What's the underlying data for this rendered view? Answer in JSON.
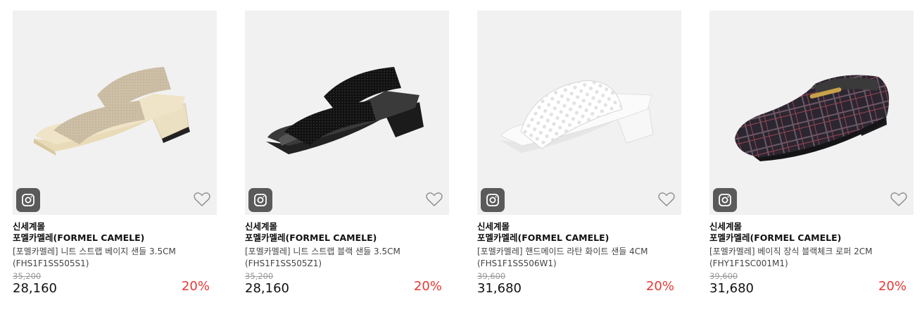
{
  "colors": {
    "discount": "#e53935",
    "thumb_bg": "#f1f1f1",
    "insta_badge": "#5a5a5a"
  },
  "products": [
    {
      "seller": "신세계몰",
      "brand": "포멜카멜레(FORMEL CAMELE)",
      "name": "[포멜카멜레] 니트 스트랩 베이지 샌들 3.5CM (FHS1F1SS505S1)",
      "original_price": "35,200",
      "price": "28,160",
      "discount": "20%",
      "image_icon": "beige-knit-strap-sandal"
    },
    {
      "seller": "신세계몰",
      "brand": "포멜카멜레(FORMEL CAMELE)",
      "name": "[포멜카멜레] 니트 스트랩 블랙 샌들 3.5CM (FHS1F1SS505Z1)",
      "original_price": "35,200",
      "price": "28,160",
      "discount": "20%",
      "image_icon": "black-knit-strap-sandal"
    },
    {
      "seller": "신세계몰",
      "brand": "포멜카멜레(FORMEL CAMELE)",
      "name": "[포멜카멜레] 핸드메이드 라탄 화이트 샌들 4CM (FHS1F1SS506W1)",
      "original_price": "39,600",
      "price": "31,680",
      "discount": "20%",
      "image_icon": "white-rattan-sandal"
    },
    {
      "seller": "신세계몰",
      "brand": "포멜카멜레(FORMEL CAMELE)",
      "name": "[포멜카멜레] 베이직 장식 블랙체크 로퍼 2CM (FHY1F1SC001M1)",
      "original_price": "39,600",
      "price": "31,680",
      "discount": "20%",
      "image_icon": "black-check-loafer"
    }
  ]
}
